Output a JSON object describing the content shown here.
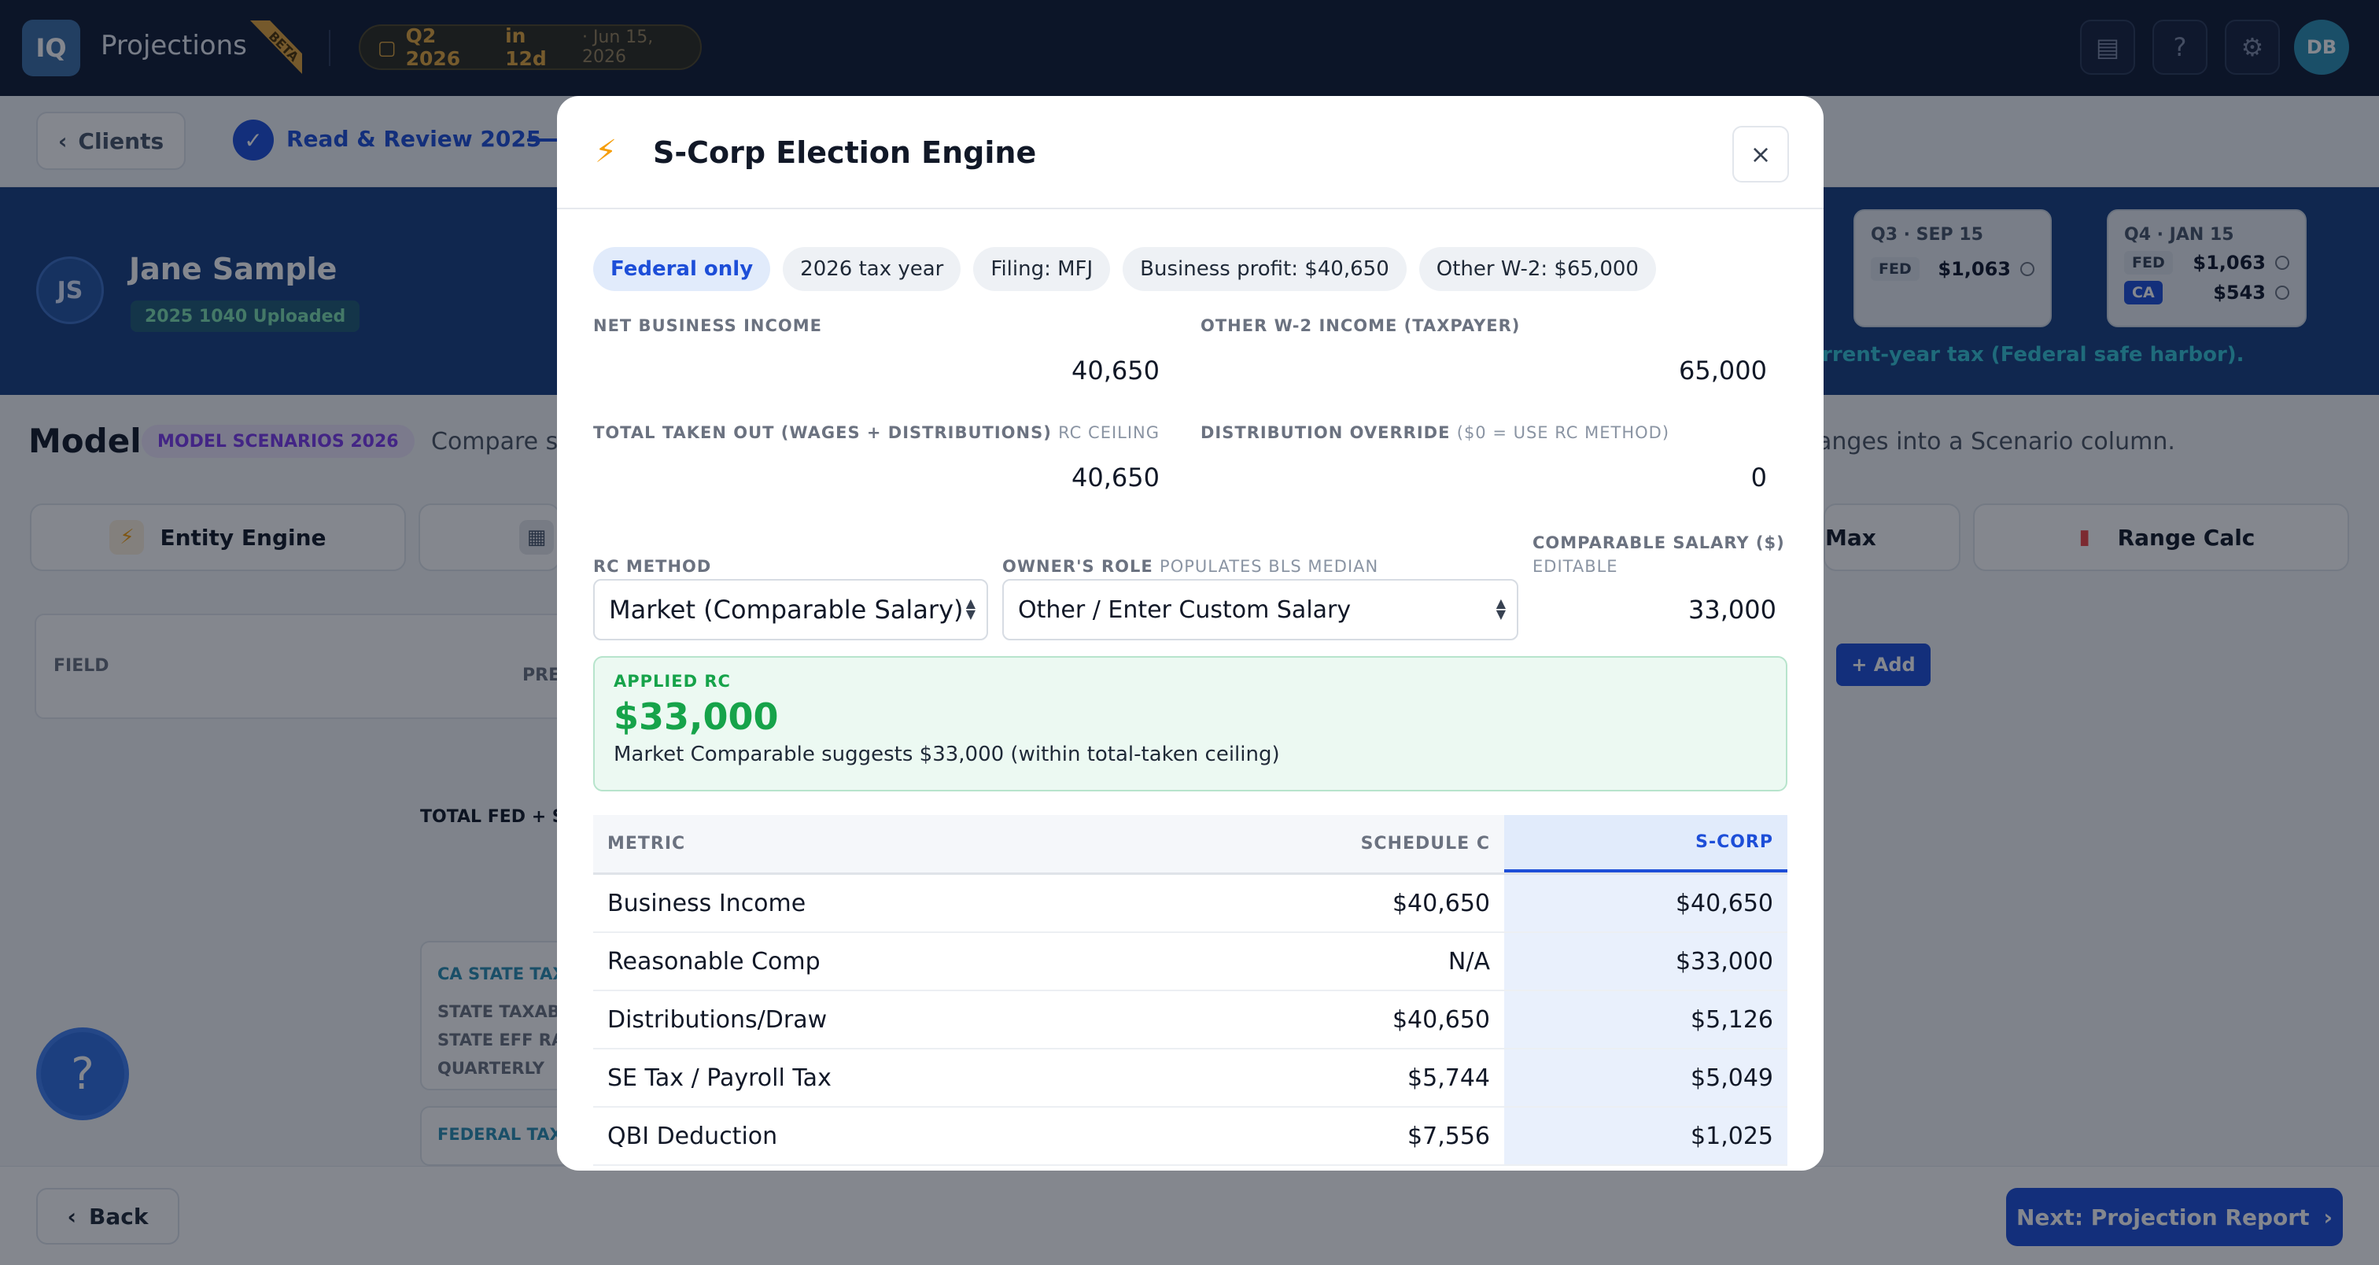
{
  "topbar": {
    "logo_text": "IQ",
    "app_title": "Projections",
    "beta_label": "BETA",
    "quarter_label": "Q2 2026",
    "quarter_due": "in 12d",
    "quarter_date": "· Jun 15, 2026",
    "avatar_initials": "DB",
    "icons": [
      "clipboard-icon",
      "help-circle-icon",
      "gear-icon"
    ]
  },
  "wizard": {
    "back_label": "Clients",
    "step1_label": "Read & Review 2025"
  },
  "client": {
    "initials": "JS",
    "name": "Jane Sample",
    "badge": "2025 1040 Uploaded",
    "q3": {
      "header": "Q3 · SEP 15",
      "fed_tag": "FED",
      "fed_value": "$1,063"
    },
    "q4": {
      "header": "Q4 · JAN 15",
      "fed_tag": "FED",
      "fed_value": "$1,063",
      "ca_tag": "CA",
      "ca_value": "$543"
    },
    "safe_harbor_text": "rrent-year tax (Federal safe harbor)."
  },
  "model": {
    "title": "Model",
    "badge": "MODEL SCENARIOS 2026",
    "subtitle_left": "Compare si",
    "subtitle_right": "anges into a Scenario column.",
    "tools": [
      "Entity Engine",
      "Max",
      "Range Calc"
    ],
    "table_field_header": "FIELD",
    "table_pre_header": "PRE",
    "add_label": "+ Add",
    "total_label": "TOTAL FED + STA",
    "state_card": {
      "title": "CA STATE TAX",
      "lines": [
        "STATE TAXAB",
        "STATE EFF RAT",
        "QUARTERLY"
      ]
    },
    "federal_card_title": "FEDERAL TAX"
  },
  "footer": {
    "back_label": "Back",
    "next_label": "Next: Projection Report"
  },
  "modal": {
    "title": "S-Corp Election Engine",
    "close_label": "×",
    "chips": [
      "Federal only",
      "2026 tax year",
      "Filing: MFJ",
      "Business profit: $40,650",
      "Other W-2: $65,000"
    ],
    "net_business_income": {
      "label": "NET BUSINESS INCOME",
      "value": "40,650"
    },
    "other_w2": {
      "label": "OTHER W-2 INCOME (TAXPAYER)",
      "value": "65,000"
    },
    "total_taken": {
      "label": "TOTAL TAKEN OUT (WAGES + DISTRIBUTIONS)",
      "sub": "RC CEILING",
      "value": "40,650"
    },
    "dist_override": {
      "label": "DISTRIBUTION OVERRIDE",
      "sub": "($0 = USE RC METHOD)",
      "value": "0"
    },
    "rc_method": {
      "label": "RC METHOD",
      "value": "Market (Comparable Salary)"
    },
    "owner_role": {
      "label": "OWNER'S ROLE",
      "sub": "POPULATES BLS MEDIAN",
      "value": "Other / Enter Custom Salary"
    },
    "comparable_salary": {
      "label": "COMPARABLE SALARY ($)",
      "sub": "EDITABLE",
      "value": "33,000"
    },
    "applied_rc": {
      "label": "APPLIED RC",
      "value": "$33,000",
      "description": "Market Comparable suggests $33,000 (within total-taken ceiling)"
    },
    "table": {
      "headers": [
        "METRIC",
        "SCHEDULE C",
        "S-CORP"
      ],
      "rows": [
        [
          "Business Income",
          "$40,650",
          "$40,650"
        ],
        [
          "Reasonable Comp",
          "N/A",
          "$33,000"
        ],
        [
          "Distributions/Draw",
          "$40,650",
          "$5,126"
        ],
        [
          "SE Tax / Payroll Tax",
          "$5,744",
          "$5,049"
        ],
        [
          "QBI Deduction",
          "$7,556",
          "$1,025"
        ]
      ]
    }
  },
  "colors": {
    "accent_blue": "#1d4ed8",
    "success_green": "#16a34a",
    "topbar_bg": "#0f1a33",
    "banner_bg": "#163f80",
    "quarter_gold": "#e2a73c"
  }
}
